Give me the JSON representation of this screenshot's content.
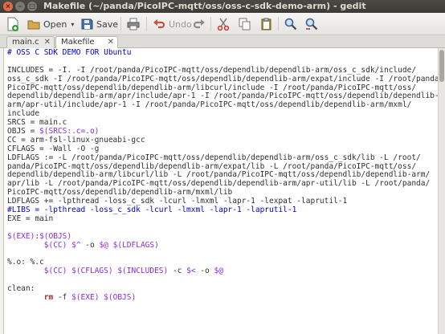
{
  "window": {
    "title": "Makefile (~/panda/PicoIPC-mqtt/oss/oss-c-sdk-demo-arm) - gedit"
  },
  "toolbar": {
    "new_label": "",
    "open_label": "Open",
    "save_label": "Save",
    "undo_label": "Undo"
  },
  "tabs": [
    {
      "label": "main.c",
      "close": "✕"
    },
    {
      "label": "Makefile",
      "close": "✕"
    }
  ],
  "editor": {
    "lines": [
      "# OSS C SDK DEMO FOR Ubuntu",
      "",
      "INCLUDES = -I. -I /root/panda/PicoIPC-mqtt/oss/dependlib/dependlib-arm/oss_c_sdk/include/",
      "oss_c_sdk -I /root/panda/PicoIPC-mqtt/oss/dependlib/dependlib-arm/expat/include -I /root/panda/",
      "PicoIPC-mqtt/oss/dependlib/dependlib-arm/libcurl/include -I /root/panda/PicoIPC-mqtt/oss/",
      "dependlib/dependlib-arm/apr/include/apr-1 -I /root/panda/PicoIPC-mqtt/oss/dependlib/dependlib-",
      "arm/apr-util/include/apr-1 -I /root/panda/PicoIPC-mqtt/oss/dependlib/dependlib-arm/mxml/",
      "include",
      "SRCS = main.c",
      "OBJS = $(SRCS:.c=.o)",
      "CC = arm-fsl-linux-gnueabi-gcc",
      "CFLAGS = -Wall -O -g",
      "LDFLAGS := -L /root/panda/PicoIPC-mqtt/oss/dependlib/dependlib-arm/oss_c_sdk/lib -L /root/",
      "panda/PicoIPC-mqtt/oss/dependlib/dependlib-arm/expat/lib -L /root/panda/PicoIPC-mqtt/oss/",
      "dependlib/dependlib-arm/libcurl/lib -L /root/panda/PicoIPC-mqtt/oss/dependlib/dependlib-arm/",
      "apr/lib -L /root/panda/PicoIPC-mqtt/oss/dependlib/dependlib-arm/apr-util/lib -L /root/panda/",
      "PicoIPC-mqtt/oss/dependlib/dependlib-arm/mxml/lib",
      "LDFLAGS += -lpthread -loss_c_sdk -lcurl -lmxml -lapr-1 -lexpat -laprutil-1",
      "#LIBS = -lpthread -loss_c_sdk -lcurl -lmxml -lapr-1 -laprutil-1",
      "EXE = main",
      "",
      "$(EXE):$(OBJS)",
      "        $(CC) $^ -o $@ $(LDFLAGS)",
      "",
      "%.o: %.c",
      "        $(CC) $(CFLAGS) $(INCLUDES) -c $< -o $@",
      "",
      "clean:",
      "        rm -f $(EXE) $(OBJS)"
    ]
  },
  "colors": {
    "titlebar": "#3c3b37",
    "comment": "#0000cc",
    "variable": "#8a2be2",
    "keyword": "#a52a2a"
  },
  "icons": [
    "new-document-icon",
    "open-icon",
    "save-icon",
    "print-icon",
    "undo-icon",
    "redo-icon",
    "cut-icon",
    "copy-icon",
    "paste-icon",
    "find-icon",
    "find-replace-icon"
  ]
}
